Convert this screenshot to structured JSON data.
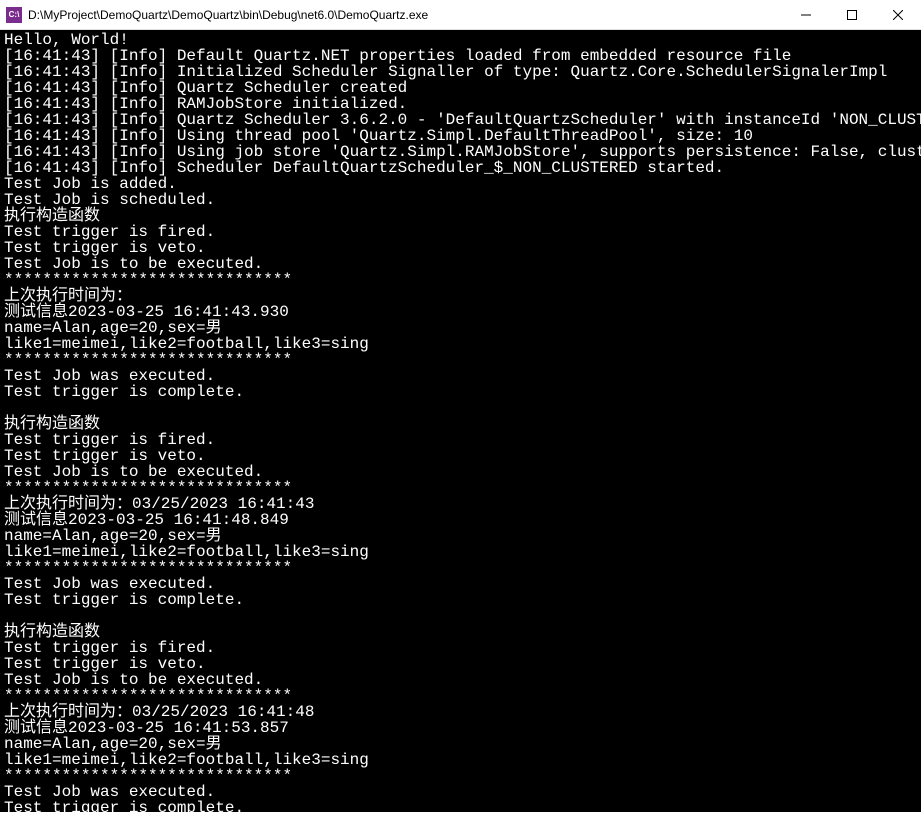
{
  "window": {
    "icon_text": "C:\\",
    "title": "D:\\MyProject\\DemoQuartz\\DemoQuartz\\bin\\Debug\\net6.0\\DemoQuartz.exe"
  },
  "lines": [
    "Hello, World!",
    "[16:41:43] [Info] Default Quartz.NET properties loaded from embedded resource file",
    "[16:41:43] [Info] Initialized Scheduler Signaller of type: Quartz.Core.SchedulerSignalerImpl",
    "[16:41:43] [Info] Quartz Scheduler created",
    "[16:41:43] [Info] RAMJobStore initialized.",
    "[16:41:43] [Info] Quartz Scheduler 3.6.2.0 - 'DefaultQuartzScheduler' with instanceId 'NON_CLUSTERED' initialized",
    "[16:41:43] [Info] Using thread pool 'Quartz.Simpl.DefaultThreadPool', size: 10",
    "[16:41:43] [Info] Using job store 'Quartz.Simpl.RAMJobStore', supports persistence: False, clustered: False",
    "[16:41:43] [Info] Scheduler DefaultQuartzScheduler_$_NON_CLUSTERED started.",
    "Test Job is added.",
    "Test Job is scheduled.",
    "执行构造函数",
    "Test trigger is fired.",
    "Test trigger is veto.",
    "Test Job is to be executed.",
    "******************************",
    "上次执行时间为：",
    "测试信息2023-03-25 16:41:43.930",
    "name=Alan,age=20,sex=男",
    "like1=meimei,like2=football,like3=sing",
    "******************************",
    "Test Job was executed.",
    "Test trigger is complete.",
    "",
    "执行构造函数",
    "Test trigger is fired.",
    "Test trigger is veto.",
    "Test Job is to be executed.",
    "******************************",
    "上次执行时间为：03/25/2023 16:41:43",
    "测试信息2023-03-25 16:41:48.849",
    "name=Alan,age=20,sex=男",
    "like1=meimei,like2=football,like3=sing",
    "******************************",
    "Test Job was executed.",
    "Test trigger is complete.",
    "",
    "执行构造函数",
    "Test trigger is fired.",
    "Test trigger is veto.",
    "Test Job is to be executed.",
    "******************************",
    "上次执行时间为：03/25/2023 16:41:48",
    "测试信息2023-03-25 16:41:53.857",
    "name=Alan,age=20,sex=男",
    "like1=meimei,like2=football,like3=sing",
    "******************************",
    "Test Job was executed.",
    "Test trigger is complete."
  ]
}
